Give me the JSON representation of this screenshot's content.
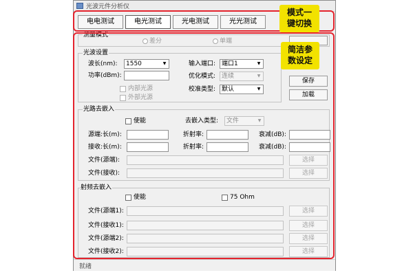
{
  "window": {
    "title": "光波元件分析仪"
  },
  "tabs": [
    {
      "label": "电电测试",
      "active": false
    },
    {
      "label": "电光测试",
      "active": true
    },
    {
      "label": "光电测试",
      "active": false
    },
    {
      "label": "光光测试",
      "active": false
    }
  ],
  "callouts": {
    "mode_switch": {
      "line1": "模式一",
      "line2": "键切换"
    },
    "param_setting": {
      "line1": "简洁参",
      "line2": "数设定"
    }
  },
  "measure_mode": {
    "title": "测量模式",
    "options": [
      "差分",
      "单端"
    ]
  },
  "optical_setting": {
    "title": "光波设置",
    "wavelength_label": "波长(nm):",
    "wavelength_value": "1550",
    "power_label": "功率(dBm):",
    "internal_source": "内部光源",
    "external_source": "外部光源",
    "input_port_label": "输入端口:",
    "input_port_value": "端口1",
    "optimize_label": "优化模式:",
    "optimize_value": "连续",
    "calib_label": "校准类型:",
    "calib_value": "默认"
  },
  "buttons": {
    "save": "保存",
    "load": "加载"
  },
  "optical_deembed": {
    "title": "光路去嵌入",
    "enable": "使能",
    "type_label": "去嵌入类型:",
    "type_value": "文件",
    "src_len": "源端:长(m):",
    "src_index": "折射率:",
    "src_loss": "衰减(dB):",
    "rcv_len": "接收:长(m):",
    "rcv_index": "折射率:",
    "rcv_loss": "衰减(dB):",
    "file_src": "文件(源端):",
    "file_rcv": "文件(接收):",
    "select": "选择"
  },
  "rf_deembed": {
    "title": "射频去嵌入",
    "enable": "使能",
    "ohm75": "75 Ohm",
    "file_src1": "文件(源端1):",
    "file_rcv1": "文件(接收1):",
    "file_src2": "文件(源端2):",
    "file_rcv2": "文件(接收2):",
    "select": "选择"
  },
  "status": {
    "text": "就绪"
  },
  "colors": {
    "callout": "#f2e200",
    "highlight_border": "#e4232d",
    "window_bg": "#f0f0f0"
  }
}
